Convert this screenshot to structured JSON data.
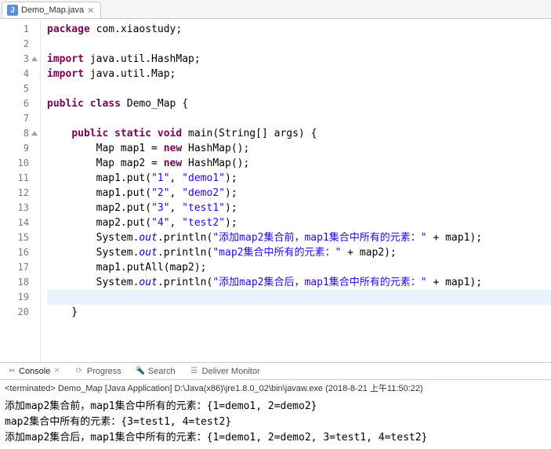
{
  "tab": {
    "filename": "Demo_Map.java",
    "icon_letter": "J"
  },
  "code": {
    "lines": [
      {
        "n": 1,
        "tokens": [
          [
            "kw",
            "package"
          ],
          [
            "",
            " com.xiaostudy;"
          ]
        ]
      },
      {
        "n": 2,
        "tokens": []
      },
      {
        "n": 3,
        "fold": true,
        "tokens": [
          [
            "kw",
            "import"
          ],
          [
            "",
            " java.util.HashMap;"
          ]
        ]
      },
      {
        "n": 4,
        "tokens": [
          [
            "kw",
            "import"
          ],
          [
            "",
            " java.util.Map;"
          ]
        ]
      },
      {
        "n": 5,
        "tokens": []
      },
      {
        "n": 6,
        "tokens": [
          [
            "kw",
            "public"
          ],
          [
            "",
            " "
          ],
          [
            "kw",
            "class"
          ],
          [
            "",
            " Demo_Map {"
          ]
        ]
      },
      {
        "n": 7,
        "tokens": []
      },
      {
        "n": 8,
        "fold": true,
        "tokens": [
          [
            "",
            "    "
          ],
          [
            "kw",
            "public"
          ],
          [
            "",
            " "
          ],
          [
            "kw",
            "static"
          ],
          [
            "",
            " "
          ],
          [
            "kw",
            "void"
          ],
          [
            "",
            " main(String[] args) {"
          ]
        ]
      },
      {
        "n": 9,
        "tokens": [
          [
            "",
            "        Map map1 = "
          ],
          [
            "kw",
            "new"
          ],
          [
            "",
            " HashMap();"
          ]
        ]
      },
      {
        "n": 10,
        "tokens": [
          [
            "",
            "        Map map2 = "
          ],
          [
            "kw",
            "new"
          ],
          [
            "",
            " HashMap();"
          ]
        ]
      },
      {
        "n": 11,
        "tokens": [
          [
            "",
            "        map1.put("
          ],
          [
            "str",
            "\"1\""
          ],
          [
            "",
            ", "
          ],
          [
            "str",
            "\"demo1\""
          ],
          [
            "",
            ");"
          ]
        ]
      },
      {
        "n": 12,
        "tokens": [
          [
            "",
            "        map1.put("
          ],
          [
            "str",
            "\"2\""
          ],
          [
            "",
            ", "
          ],
          [
            "str",
            "\"demo2\""
          ],
          [
            "",
            ");"
          ]
        ]
      },
      {
        "n": 13,
        "tokens": [
          [
            "",
            "        map2.put("
          ],
          [
            "str",
            "\"3\""
          ],
          [
            "",
            ", "
          ],
          [
            "str",
            "\"test1\""
          ],
          [
            "",
            ");"
          ]
        ]
      },
      {
        "n": 14,
        "tokens": [
          [
            "",
            "        map2.put("
          ],
          [
            "str",
            "\"4\""
          ],
          [
            "",
            ", "
          ],
          [
            "str",
            "\"test2\""
          ],
          [
            "",
            ");"
          ]
        ]
      },
      {
        "n": 15,
        "tokens": [
          [
            "",
            "        System."
          ],
          [
            "fld",
            "out"
          ],
          [
            "",
            ".println("
          ],
          [
            "str",
            "\"添加map2集合前，map1集合中所有的元素：\""
          ],
          [
            "",
            " + map1);"
          ]
        ]
      },
      {
        "n": 16,
        "tokens": [
          [
            "",
            "        System."
          ],
          [
            "fld",
            "out"
          ],
          [
            "",
            ".println("
          ],
          [
            "str",
            "\"map2集合中所有的元素：\""
          ],
          [
            "",
            " + map2);"
          ]
        ]
      },
      {
        "n": 17,
        "tokens": [
          [
            "",
            "        map1.putAll(map2);"
          ]
        ]
      },
      {
        "n": 18,
        "tokens": [
          [
            "",
            "        System."
          ],
          [
            "fld",
            "out"
          ],
          [
            "",
            ".println("
          ],
          [
            "str",
            "\"添加map2集合后，map1集合中所有的元素：\""
          ],
          [
            "",
            " + map1);"
          ]
        ]
      },
      {
        "n": 19,
        "hl": true,
        "tokens": []
      },
      {
        "n": 20,
        "tokens": [
          [
            "",
            "    }"
          ]
        ]
      }
    ]
  },
  "panel": {
    "tabs": [
      {
        "label": "Console",
        "active": true,
        "iconClass": "console",
        "glyph": "▭"
      },
      {
        "label": "Progress",
        "active": false,
        "iconClass": "progress",
        "glyph": "⟳"
      },
      {
        "label": "Search",
        "active": false,
        "iconClass": "search",
        "glyph": "🔦"
      },
      {
        "label": "Deliver Monitor",
        "active": false,
        "iconClass": "deliver",
        "glyph": "☰"
      }
    ]
  },
  "terminated": "<terminated> Demo_Map [Java Application] D:\\Java(x86)\\jre1.8.0_02\\bin\\javaw.exe (2018-8-21 上午11:50:22)",
  "console_output": [
    "添加map2集合前，map1集合中所有的元素：{1=demo1, 2=demo2}",
    "map2集合中所有的元素：{3=test1, 4=test2}",
    "添加map2集合后，map1集合中所有的元素：{1=demo1, 2=demo2, 3=test1, 4=test2}"
  ]
}
